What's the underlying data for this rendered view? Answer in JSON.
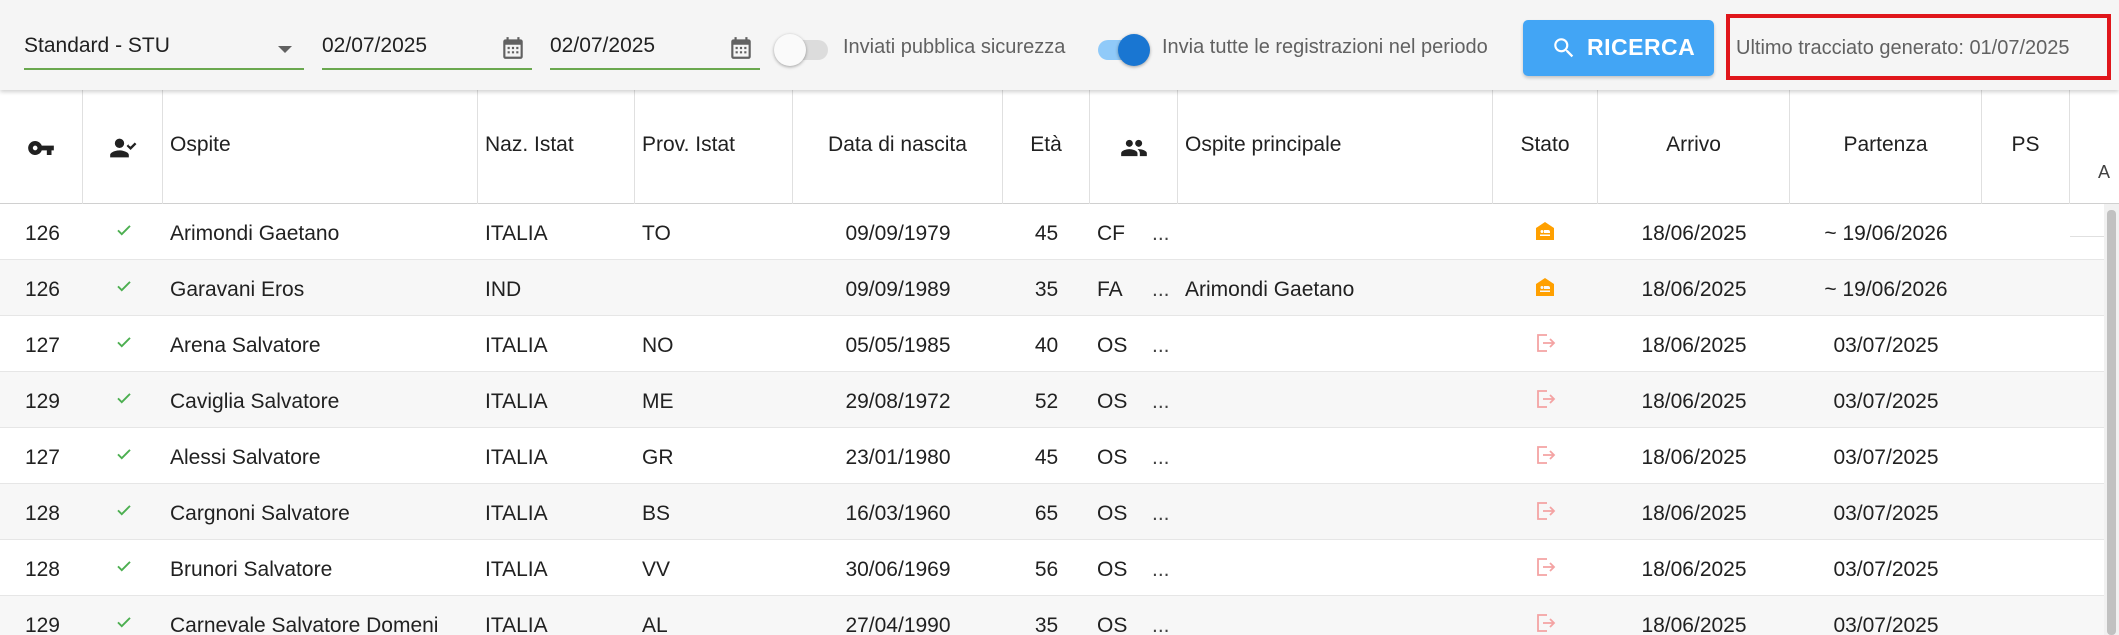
{
  "toolbar": {
    "mode_select": "Standard - STU",
    "date_from": "02/07/2025",
    "date_to": "02/07/2025",
    "toggle_public_security": {
      "label": "Inviati pubblica sicurezza",
      "checked": false
    },
    "toggle_all_registrations": {
      "label": "Invia tutte le registrazioni nel periodo",
      "checked": true
    },
    "search_button": "RICERCA",
    "last_generated": "Ultimo tracciato generato: 01/07/2025"
  },
  "table": {
    "headers": {
      "key": "key-icon",
      "checked": "person-check-icon",
      "guest": "Ospite",
      "nationality": "Naz. Istat",
      "province": "Prov. Istat",
      "birth_date": "Data di nascita",
      "age": "Età",
      "group": "group-icon",
      "main_guest": "Ospite principale",
      "status": "Stato",
      "arrival": "Arrivo",
      "departure": "Partenza",
      "ps": "PS",
      "next_partial": "A"
    },
    "rows": [
      {
        "room": "126",
        "guest": "Arimondi Gaetano",
        "nationality": "ITALIA",
        "province": "TO",
        "birth_date": "09/09/1979",
        "age": "45",
        "type": "CF",
        "more": "...",
        "main_guest": "",
        "status": "in-house",
        "arrival": "18/06/2025",
        "departure": "~ 19/06/2026"
      },
      {
        "room": "126",
        "guest": "Garavani Eros",
        "nationality": "IND",
        "province": "",
        "birth_date": "09/09/1989",
        "age": "35",
        "type": "FA",
        "more": "...",
        "main_guest": "Arimondi Gaetano",
        "status": "in-house",
        "arrival": "18/06/2025",
        "departure": "~ 19/06/2026"
      },
      {
        "room": "127",
        "guest": "Arena Salvatore",
        "nationality": "ITALIA",
        "province": "NO",
        "birth_date": "05/05/1985",
        "age": "40",
        "type": "OS",
        "more": "...",
        "main_guest": "",
        "status": "checked-out",
        "arrival": "18/06/2025",
        "departure": "03/07/2025"
      },
      {
        "room": "129",
        "guest": "Caviglia Salvatore",
        "nationality": "ITALIA",
        "province": "ME",
        "birth_date": "29/08/1972",
        "age": "52",
        "type": "OS",
        "more": "...",
        "main_guest": "",
        "status": "checked-out",
        "arrival": "18/06/2025",
        "departure": "03/07/2025"
      },
      {
        "room": "127",
        "guest": "Alessi Salvatore",
        "nationality": "ITALIA",
        "province": "GR",
        "birth_date": "23/01/1980",
        "age": "45",
        "type": "OS",
        "more": "...",
        "main_guest": "",
        "status": "checked-out",
        "arrival": "18/06/2025",
        "departure": "03/07/2025"
      },
      {
        "room": "128",
        "guest": "Cargnoni Salvatore",
        "nationality": "ITALIA",
        "province": "BS",
        "birth_date": "16/03/1960",
        "age": "65",
        "type": "OS",
        "more": "...",
        "main_guest": "",
        "status": "checked-out",
        "arrival": "18/06/2025",
        "departure": "03/07/2025"
      },
      {
        "room": "128",
        "guest": "Brunori Salvatore",
        "nationality": "ITALIA",
        "province": "VV",
        "birth_date": "30/06/1969",
        "age": "56",
        "type": "OS",
        "more": "...",
        "main_guest": "",
        "status": "checked-out",
        "arrival": "18/06/2025",
        "departure": "03/07/2025"
      },
      {
        "room": "129",
        "guest": "Carnevale Salvatore Domeni",
        "nationality": "ITALIA",
        "province": "AL",
        "birth_date": "27/04/1990",
        "age": "35",
        "type": "OS",
        "more": "...",
        "main_guest": "",
        "status": "checked-out",
        "arrival": "18/06/2025",
        "departure": "03/07/2025"
      }
    ]
  },
  "colors": {
    "accent_blue": "#42a5f5",
    "toggle_on": "#1976d2",
    "field_underline": "#6aa84f",
    "check_green": "#4caf50",
    "status_inhouse": "#ffa000",
    "status_checkedout": "#f4a3a3",
    "highlight_border": "#e0161b"
  }
}
